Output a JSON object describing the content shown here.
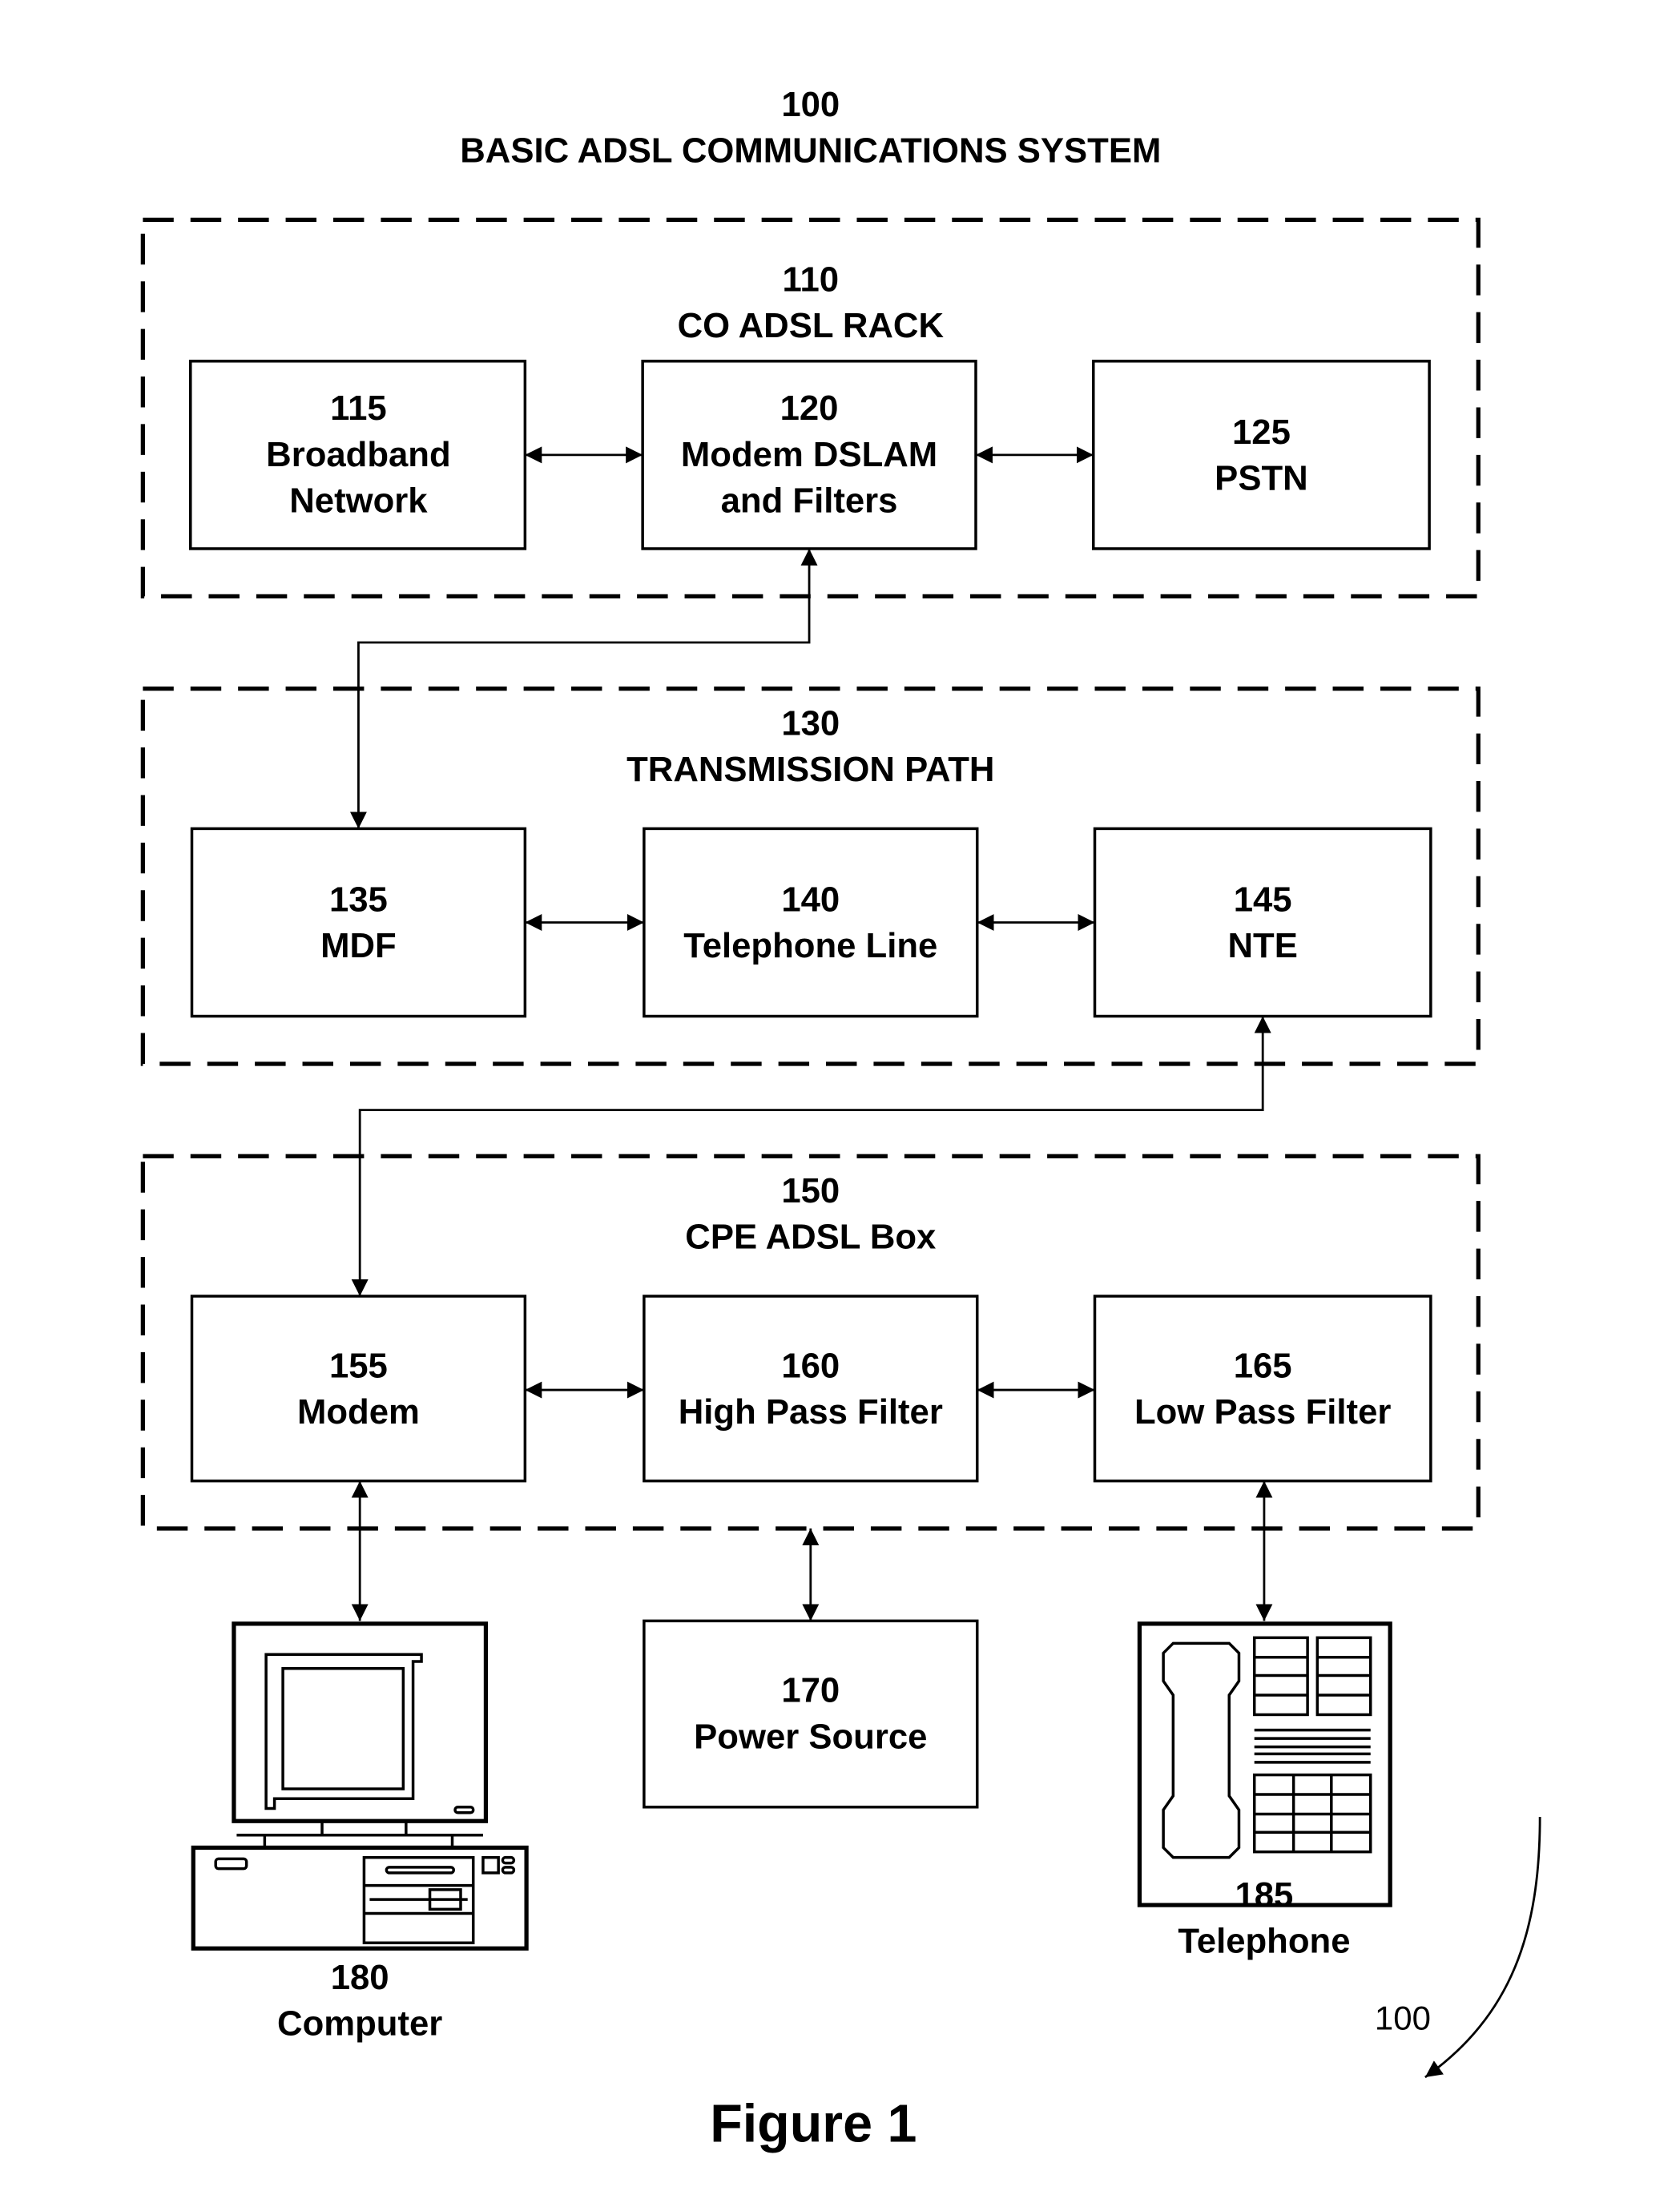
{
  "diagram": {
    "number": "100",
    "title": "BASIC ADSL COMMUNICATIONS SYSTEM",
    "figure_label": "Figure 1",
    "reference_label": "100",
    "groups": [
      {
        "id": "110",
        "title": "CO ADSL RACK",
        "blocks": [
          {
            "id": "115",
            "lines": [
              "115",
              "Broadband",
              "Network"
            ]
          },
          {
            "id": "120",
            "lines": [
              "120",
              "Modem DSLAM",
              "and Filters"
            ]
          },
          {
            "id": "125",
            "lines": [
              "125",
              "PSTN"
            ]
          }
        ]
      },
      {
        "id": "130",
        "title": "TRANSMISSION PATH",
        "blocks": [
          {
            "id": "135",
            "lines": [
              "135",
              "MDF"
            ]
          },
          {
            "id": "140",
            "lines": [
              "140",
              "Telephone Line"
            ]
          },
          {
            "id": "145",
            "lines": [
              "145",
              "NTE"
            ]
          }
        ]
      },
      {
        "id": "150",
        "title": "CPE ADSL Box",
        "blocks": [
          {
            "id": "155",
            "lines": [
              "155",
              "Modem"
            ]
          },
          {
            "id": "160",
            "lines": [
              "160",
              "High Pass Filter"
            ]
          },
          {
            "id": "165",
            "lines": [
              "165",
              "Low Pass Filter"
            ]
          }
        ]
      }
    ],
    "external": {
      "power": {
        "id": "170",
        "lines": [
          "170",
          "Power Source"
        ]
      },
      "computer": {
        "id": "180",
        "lines": [
          "180",
          "Computer"
        ]
      },
      "telephone": {
        "id": "185",
        "lines": [
          "185",
          "Telephone"
        ]
      }
    },
    "connections": [
      [
        "115",
        "120",
        "bidirectional"
      ],
      [
        "120",
        "125",
        "bidirectional"
      ],
      [
        "120",
        "135",
        "bidirectional"
      ],
      [
        "135",
        "140",
        "bidirectional"
      ],
      [
        "140",
        "145",
        "bidirectional"
      ],
      [
        "145",
        "155",
        "bidirectional"
      ],
      [
        "155",
        "160",
        "bidirectional"
      ],
      [
        "160",
        "165",
        "bidirectional"
      ],
      [
        "155",
        "180",
        "bidirectional"
      ],
      [
        "150",
        "170",
        "bidirectional"
      ],
      [
        "165",
        "185",
        "bidirectional"
      ]
    ]
  }
}
